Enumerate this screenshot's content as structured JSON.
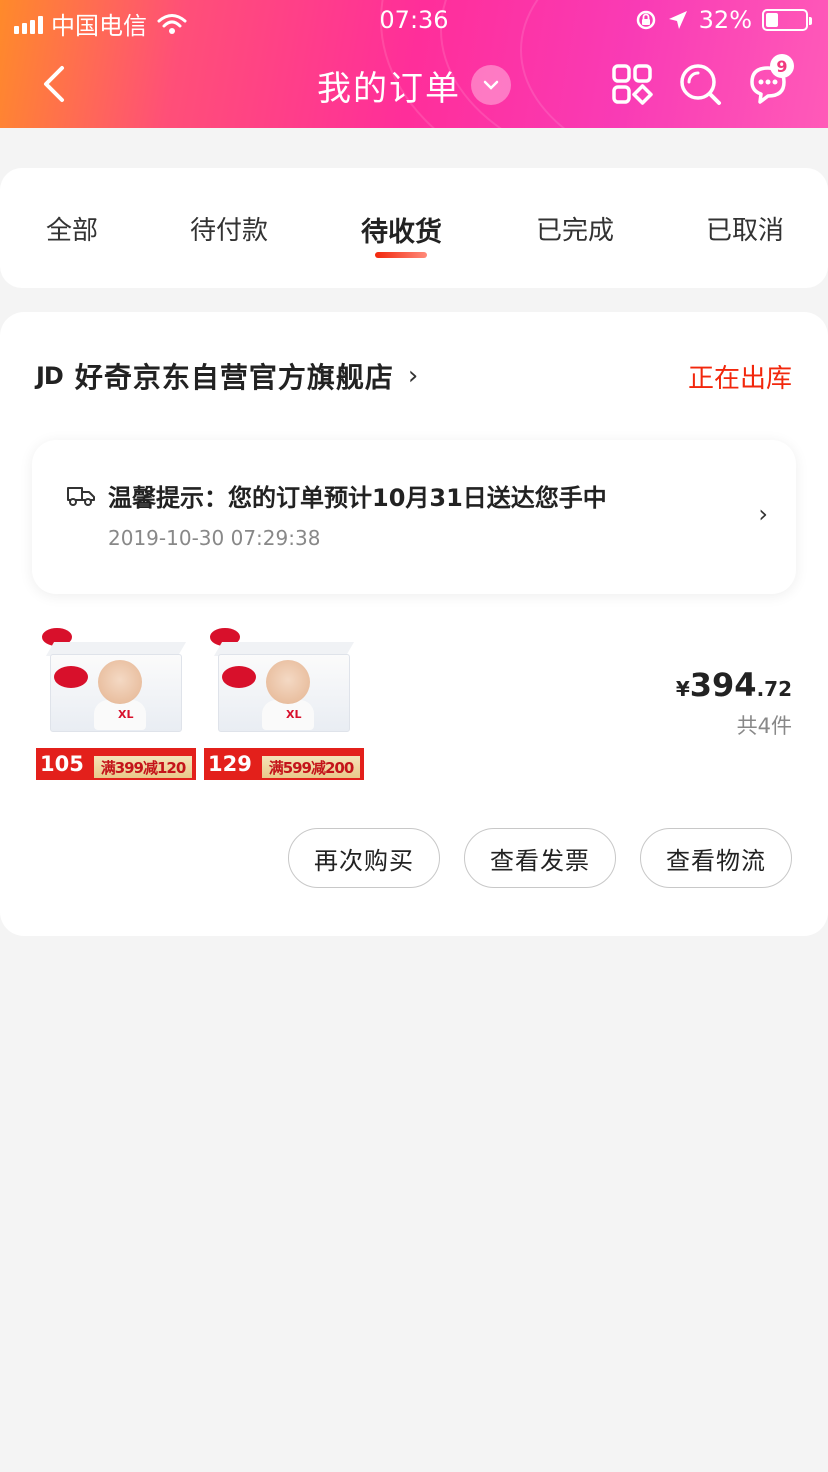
{
  "status_bar": {
    "carrier": "中国电信",
    "time": "07:36",
    "battery": "32%",
    "battery_level": 0.32
  },
  "nav": {
    "title": "我的订单",
    "message_badge": "9",
    "icons": [
      "back-icon",
      "dropdown-icon",
      "grid-menu-icon",
      "search-icon",
      "message-icon"
    ]
  },
  "tabs": [
    {
      "label": "全部"
    },
    {
      "label": "待付款"
    },
    {
      "label": "待收货",
      "active": true
    },
    {
      "label": "已完成"
    },
    {
      "label": "已取消"
    }
  ],
  "order": {
    "shop_logo": "JD",
    "shop_name": "好奇京东自营官方旗舰店",
    "status": "正在出库",
    "tip": {
      "text": "温馨提示：您的订单预计10月31日送达您手中",
      "time": "2019-10-30 07:29:38"
    },
    "products": [
      {
        "promo_price": "105",
        "promo_text": "满399减120",
        "size_label": "XL"
      },
      {
        "promo_price": "129",
        "promo_text": "满599减200",
        "size_label": "XL"
      }
    ],
    "price": {
      "currency": "¥",
      "integer": "394",
      "decimal": ".72"
    },
    "quantity": "共4件",
    "actions": [
      "再次购买",
      "查看发票",
      "查看物流"
    ]
  },
  "colors": {
    "accent_red": "#f2270c",
    "header_gradient_start": "#ff8a2a",
    "header_gradient_end": "#ff5ab8"
  }
}
